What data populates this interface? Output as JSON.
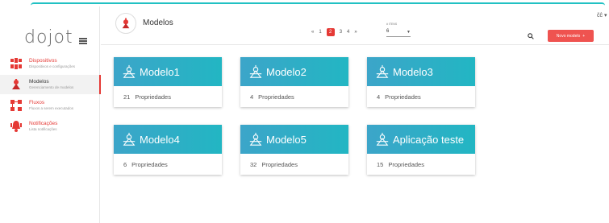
{
  "sidebar": {
    "logo": "dojot",
    "items": [
      {
        "title": "Dispositivos",
        "subtitle": "Dispositivos e configurações",
        "icon": "devices-icon",
        "active": false
      },
      {
        "title": "Modelos",
        "subtitle": "Gerenciamento de modelos",
        "icon": "templates-icon",
        "active": true
      },
      {
        "title": "Fluxos",
        "subtitle": "Fluxos a serem executados",
        "icon": "flows-icon",
        "active": false
      },
      {
        "title": "Notificações",
        "subtitle": "Lista notificações",
        "icon": "bell-icon",
        "active": false
      }
    ]
  },
  "header": {
    "title": "Modelos",
    "user": "čĉ",
    "new_button": "Novo modelo",
    "new_button_icon": "+",
    "pagination": {
      "prev": "«",
      "pages": [
        "1",
        "2",
        "3",
        "4"
      ],
      "current": "2",
      "next": "»"
    },
    "per_page": {
      "label": "# ITENS",
      "value": "6"
    }
  },
  "cards": [
    {
      "title": "Modelo1",
      "count": "21",
      "label": "Propriedades"
    },
    {
      "title": "Modelo2",
      "count": "4",
      "label": "Propriedades"
    },
    {
      "title": "Modelo3",
      "count": "4",
      "label": "Propriedades"
    },
    {
      "title": "Modelo4",
      "count": "6",
      "label": "Propriedades"
    },
    {
      "title": "Modelo5",
      "count": "32",
      "label": "Propriedades"
    },
    {
      "title": "Aplicação teste",
      "count": "15",
      "label": "Propriedades"
    }
  ],
  "colors": {
    "accent": "#e53935",
    "card_start": "#3ca5c9",
    "card_end": "#22b6c3",
    "top_line": "#22c1c3"
  }
}
